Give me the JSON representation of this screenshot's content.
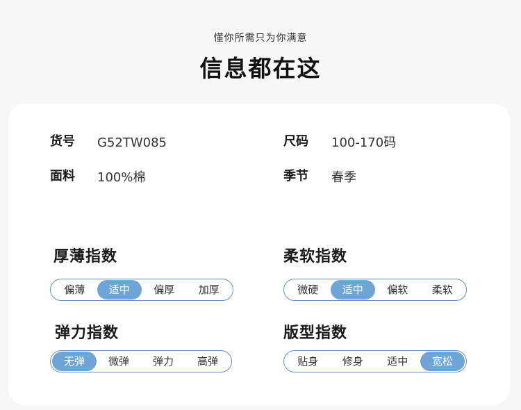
{
  "header": {
    "subtitle": "懂你所需只为你满意",
    "title": "信息都在这"
  },
  "info": {
    "item_no": {
      "label": "货号",
      "value": "G52TW085"
    },
    "size": {
      "label": "尺码",
      "value": "100-170码"
    },
    "fabric": {
      "label": "面料",
      "value": "100%棉"
    },
    "season": {
      "label": "季节",
      "value": "春季"
    }
  },
  "indices": {
    "thickness": {
      "title": "厚薄指数",
      "options": [
        "偏薄",
        "适中",
        "偏厚",
        "加厚"
      ],
      "selected": 1
    },
    "softness": {
      "title": "柔软指数",
      "options": [
        "微硬",
        "适中",
        "偏软",
        "柔软"
      ],
      "selected": 1
    },
    "elasticity": {
      "title": "弹力指数",
      "options": [
        "无弹",
        "微弹",
        "弹力",
        "高弹"
      ],
      "selected": 0
    },
    "fit": {
      "title": "版型指数",
      "options": [
        "贴身",
        "修身",
        "适中",
        "宽松"
      ],
      "selected": 3
    }
  },
  "colors": {
    "accent": "#6fa5d6",
    "border": "#5f8fc0",
    "card": "#ffffff",
    "background": "#f7f7f7"
  }
}
